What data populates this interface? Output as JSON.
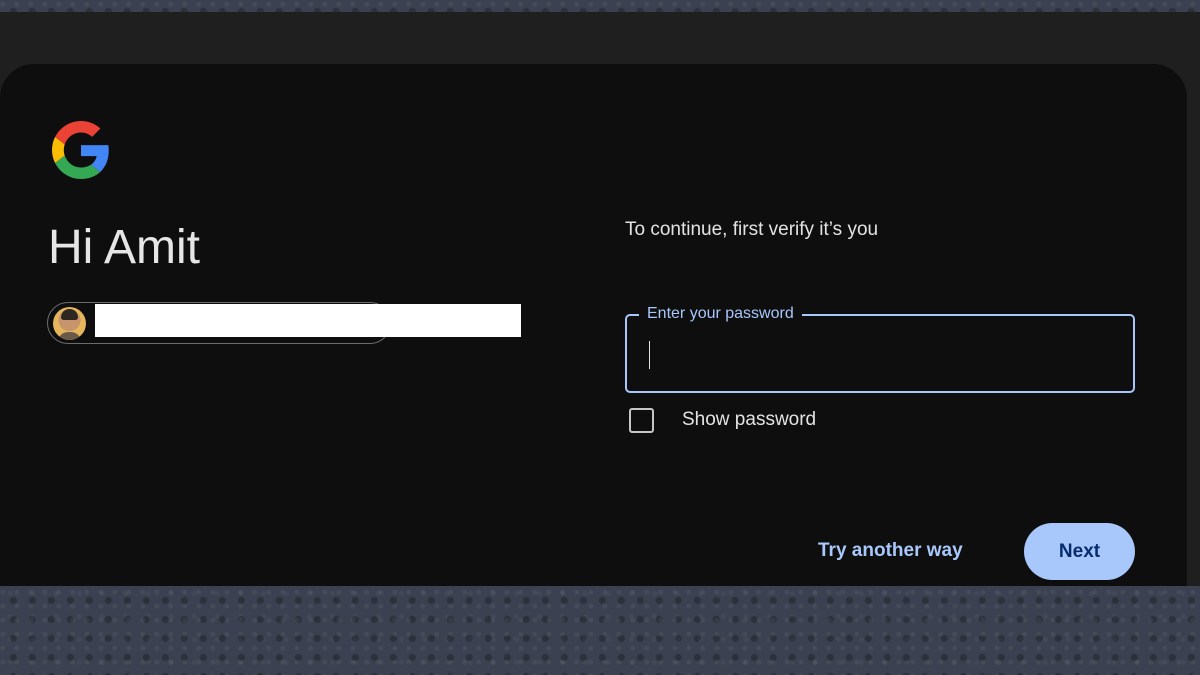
{
  "header": {
    "logo": "google-g-logo"
  },
  "greeting": "Hi Amit",
  "account": {
    "avatar": "user-avatar",
    "email_redacted": true
  },
  "verify": {
    "subtitle": "To continue, first verify it’s you",
    "password_label": "Enter your password",
    "password_value": "",
    "show_password_label": "Show password",
    "show_password_checked": false
  },
  "actions": {
    "try_another": "Try another way",
    "next": "Next"
  },
  "colors": {
    "accent": "#a8c7fa",
    "button_text": "#062e6f",
    "card_bg": "#0e0e0f"
  }
}
